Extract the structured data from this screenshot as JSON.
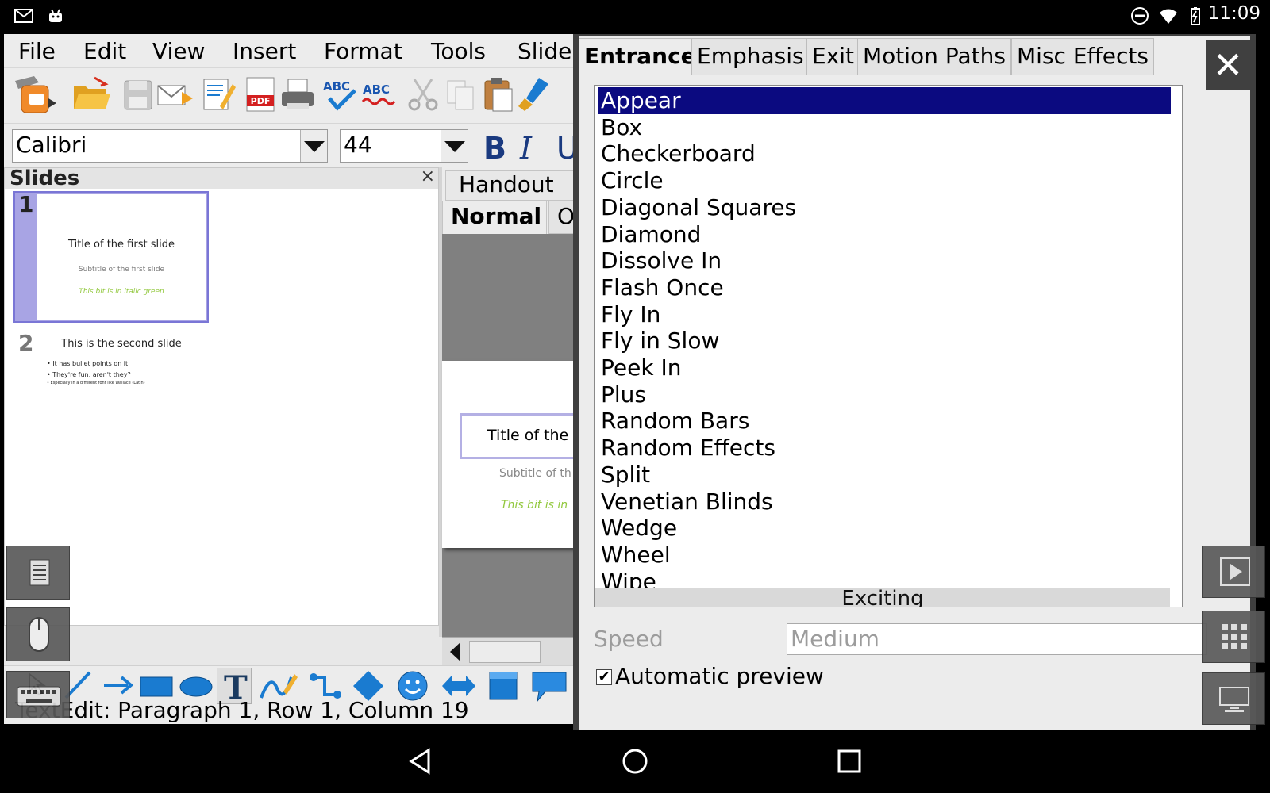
{
  "statusbar": {
    "time": "11:09"
  },
  "menubar": {
    "items": [
      "File",
      "Edit",
      "View",
      "Insert",
      "Format",
      "Tools",
      "Slide"
    ]
  },
  "format_bar": {
    "font_name": "Calibri",
    "font_size": "44"
  },
  "slides_pane": {
    "title": "Slides",
    "close": "×",
    "slide1": {
      "number": "1",
      "title": "Title of the first slide",
      "subtitle": "Subtitle of the first slide",
      "extra": "This bit is in italic green"
    },
    "slide2": {
      "number": "2",
      "title": "This is the second slide",
      "bullet1": "• It has bullet points on it",
      "bullet2": "• They're fun, aren't they?",
      "bullet3": "• Especially in a different font like Wallace (Latin)"
    }
  },
  "view_tabs": {
    "handout": "Handout",
    "normal": "Normal",
    "outline_partial": "O"
  },
  "main_slide": {
    "title_partial": "Title of the",
    "subtitle_partial": "Subtitle of th",
    "extra_partial": "This bit is in"
  },
  "status": {
    "text": "TextEdit: Paragraph 1, Row 1, Column 19"
  },
  "dialog": {
    "tabs": [
      "Entrance",
      "Emphasis",
      "Exit",
      "Motion Paths",
      "Misc Effects"
    ],
    "close": "✕",
    "effects": [
      "Appear",
      "Box",
      "Checkerboard",
      "Circle",
      "Diagonal Squares",
      "Diamond",
      "Dissolve In",
      "Flash Once",
      "Fly In",
      "Fly in Slow",
      "Peek In",
      "Plus",
      "Random Bars",
      "Random Effects",
      "Split",
      "Venetian Blinds",
      "Wedge",
      "Wheel",
      "Wipe"
    ],
    "category_next": "Exciting",
    "speed_label": "Speed",
    "speed_value": "Medium",
    "auto_preview_label": "Automatic preview",
    "auto_preview_checked": "✔"
  },
  "colors": {
    "selection": "#0b0a80",
    "slide_selected": "#a8a4e4",
    "green_text": "#92c83e",
    "accent_blue": "#1a7bd0"
  }
}
